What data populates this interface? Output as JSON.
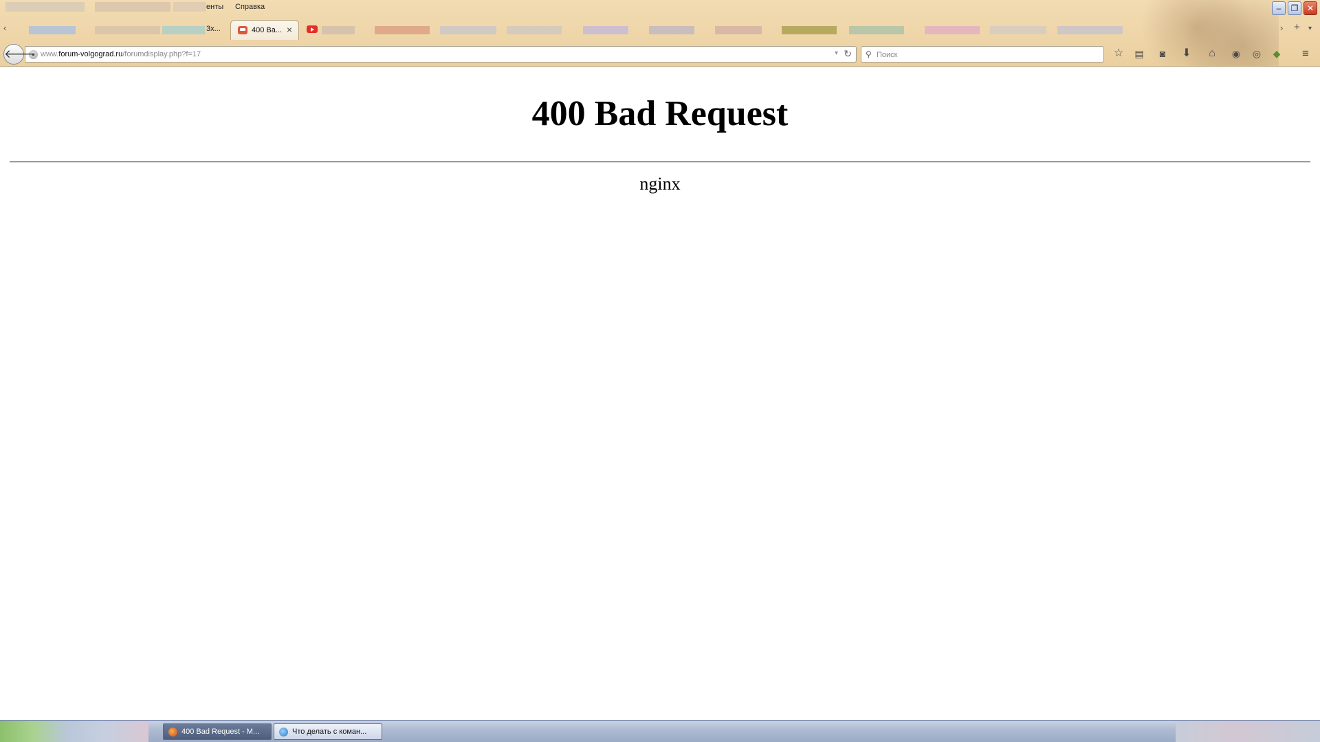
{
  "browser": {
    "menu": {
      "partial_item": "енты",
      "help": "Справка"
    },
    "active_tab": {
      "label": "400 Ba...",
      "close_glyph": "×"
    },
    "partial_tab_label": "3х...",
    "new_tab_glyph": "+",
    "tabs_scroll_left": "‹",
    "tabs_scroll_right": "›",
    "tabs_list_glyph": "▾",
    "window_controls": {
      "minimize": "–",
      "restore": "❐",
      "close": "✕"
    },
    "navigation": {
      "back_glyph": "🡐",
      "url_prefix": "www.",
      "url_host": "forum-volgograd.ru",
      "url_path": "/forumdisplay.php?f=17",
      "reload_glyph": "↻",
      "dropmarker_glyph": "▾"
    },
    "search": {
      "placeholder": "Поиск"
    },
    "toolbar_icons": [
      "star-icon",
      "reading-list-icon",
      "pocket-icon",
      "download-icon",
      "home-icon",
      "addon-icon",
      "sync-icon",
      "extension-icon",
      "menu-icon"
    ]
  },
  "page": {
    "title": "400 Bad Request",
    "server": "nginx"
  },
  "taskbar": {
    "items": [
      {
        "label": "400 Bad Request - M...",
        "icon": "firefox-icon",
        "active": true
      },
      {
        "label": "Что делать с коман...",
        "icon": "ie-icon",
        "active": false
      }
    ]
  },
  "colors": {
    "chrome_bg": "#f0d8ad",
    "accent_close": "#c53d22",
    "page_bg": "#ffffff",
    "taskbar_bg": "#aebbd2"
  }
}
